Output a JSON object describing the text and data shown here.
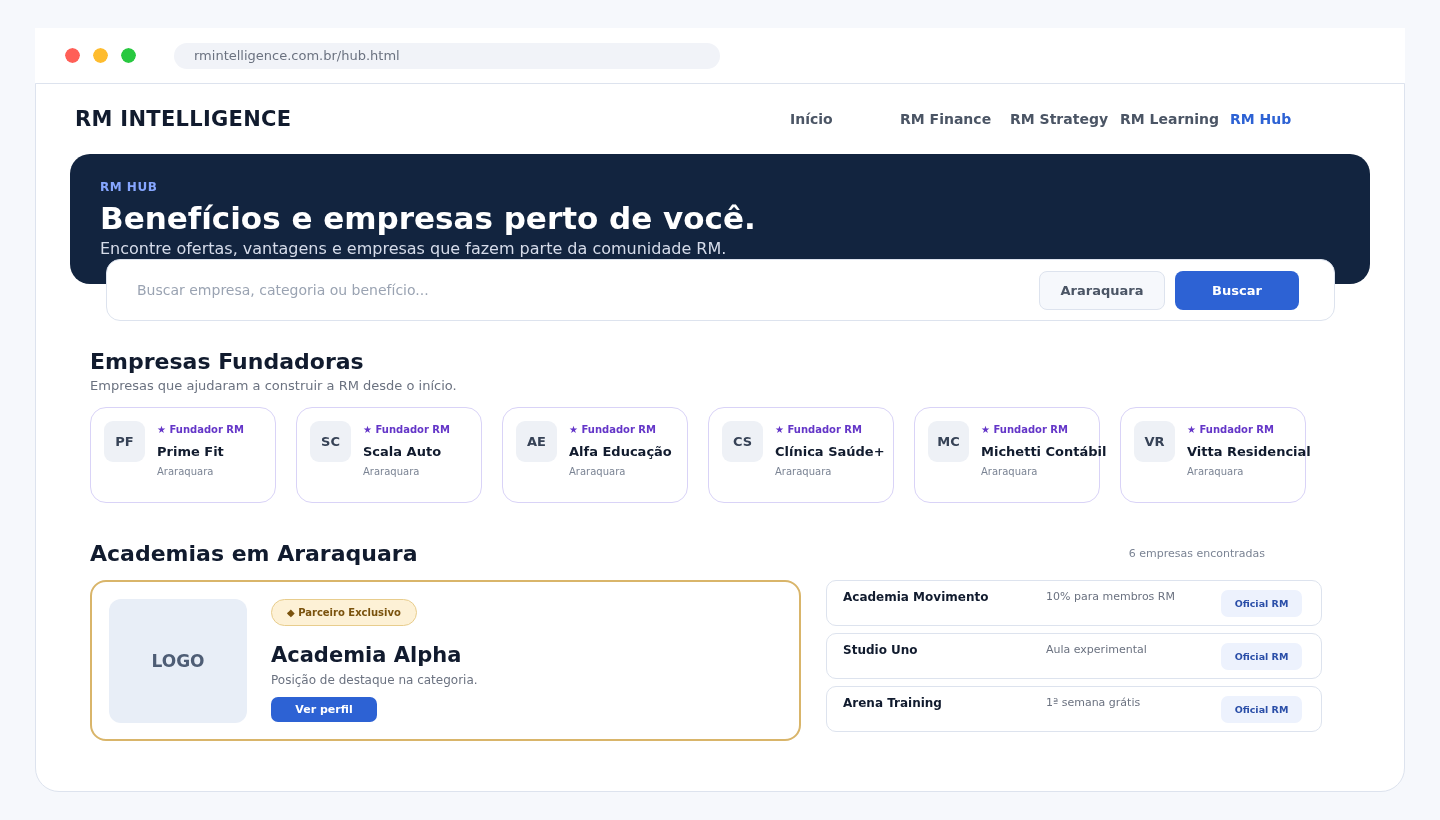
{
  "browser": {
    "url": "rmintelligence.com.br/hub.html"
  },
  "nav": {
    "logo": "RM INTELLIGENCE",
    "items": [
      {
        "label": "Início",
        "selected": false
      },
      {
        "label": "RM Finance",
        "selected": false
      },
      {
        "label": "RM Strategy",
        "selected": false
      },
      {
        "label": "RM Learning",
        "selected": false
      },
      {
        "label": "RM Hub",
        "selected": true
      }
    ]
  },
  "hero": {
    "eyebrow": "RM HUB",
    "title": "Benefícios e empresas perto de você.",
    "subtitle": "Encontre ofertas, vantagens e empresas que fazem parte da comunidade RM."
  },
  "search": {
    "placeholder": "Buscar empresa, categoria ou benefício...",
    "city": "Araraquara",
    "button": "Buscar"
  },
  "founders": {
    "title": "Empresas Fundadoras",
    "subtitle": "Empresas que ajudaram a construir a RM desde o início.",
    "cards": [
      {
        "initials": "PF",
        "badge": "★ Fundador RM",
        "name": "Prime Fit",
        "city": "Araraquara"
      },
      {
        "initials": "SC",
        "badge": "★ Fundador RM",
        "name": "Scala Auto",
        "city": "Araraquara"
      },
      {
        "initials": "AE",
        "badge": "★ Fundador RM",
        "name": "Alfa Educação",
        "city": "Araraquara"
      },
      {
        "initials": "CS",
        "badge": "★ Fundador RM",
        "name": "Clínica Saúde+",
        "city": "Araraquara"
      },
      {
        "initials": "MC",
        "badge": "★ Fundador RM",
        "name": "Michetti Contábil",
        "city": "Araraquara"
      },
      {
        "initials": "VR",
        "badge": "★ Fundador RM",
        "name": "Vitta Residencial",
        "city": "Araraquara"
      }
    ]
  },
  "category": {
    "title": "Academias em Araraquara",
    "count": "6 empresas encontradas",
    "featured": {
      "logo": "LOGO",
      "badge": "◆ Parceiro Exclusivo",
      "name": "Academia Alpha",
      "description": "Posição de destaque na categoria.",
      "button": "Ver perfil"
    },
    "list": [
      {
        "name": "Academia Movimento",
        "offer": "10% para membros RM",
        "tag": "Oficial RM"
      },
      {
        "name": "Studio Uno",
        "offer": "Aula experimental",
        "tag": "Oficial RM"
      },
      {
        "name": "Arena Training",
        "offer": "1ª semana grátis",
        "tag": "Oficial RM"
      }
    ]
  }
}
